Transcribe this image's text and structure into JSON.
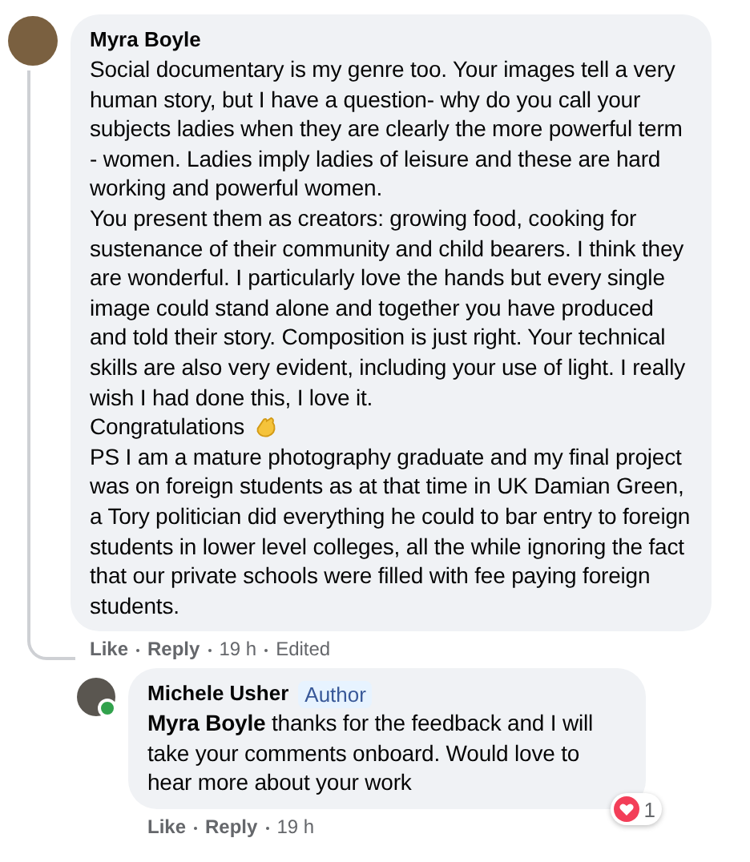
{
  "comments": [
    {
      "author": "Myra Boyle",
      "online": false,
      "paragraphs": [
        "Social documentary is my genre too. Your images tell a very human story, but I have a question- why do you call your subjects ladies when they are clearly the more powerful term - women. Ladies imply ladies of leisure and these are hard working and powerful women.",
        "You present them as creators: growing food, cooking for sustenance of their community and child bearers. I think they are wonderful. I particularly love the hands but every single image could stand alone and together you have produced and told their story. Composition is just right. Your technical skills are also very evident, including your use of light. I really wish I had done this, I love it.",
        "Congratulations",
        "PS I am a mature photography graduate and my final project was on foreign students as at that time in UK Damian Green, a Tory politician did everything he could to bar entry to foreign students in lower level colleges, all the while ignoring the fact that our private schools were filled with fee paying foreign students."
      ],
      "actions": [
        "Like",
        "Reply"
      ],
      "time": "19 h",
      "edited": "Edited"
    },
    {
      "author": "Michele Usher",
      "badge": "Author",
      "online": true,
      "paragraphs": [
        "**Myra Boyle** thanks for the feedback and I will take your comments onboard. Would love to hear more about your work"
      ],
      "actions": [
        "Like",
        "Reply"
      ],
      "time": "19 h",
      "reactions": "1"
    }
  ]
}
